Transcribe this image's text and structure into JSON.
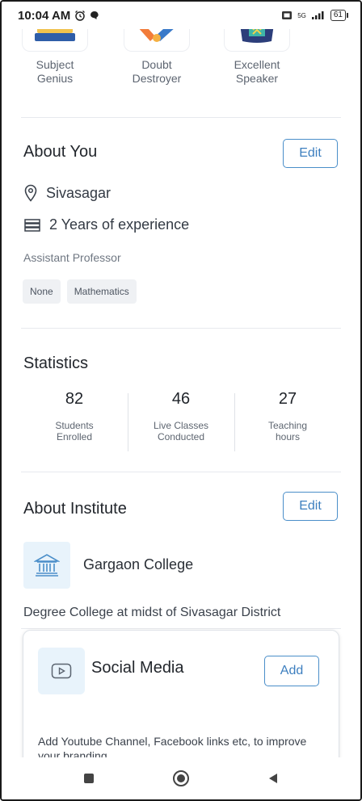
{
  "status_bar": {
    "time": "10:04 AM",
    "network": "5G",
    "battery": "61"
  },
  "badges": [
    {
      "label_line1": "Subject",
      "label_line2": "Genius",
      "icon": "books-badge-icon"
    },
    {
      "label_line1": "Doubt",
      "label_line2": "Destroyer",
      "icon": "doubt-badge-icon"
    },
    {
      "label_line1": "Excellent",
      "label_line2": "Speaker",
      "icon": "speaker-badge-icon"
    }
  ],
  "about_you": {
    "title": "About You",
    "edit_label": "Edit",
    "location": "Sivasagar",
    "experience": "2 Years of experience",
    "designation": "Assistant Professor",
    "tags": [
      "None",
      "Mathematics"
    ]
  },
  "statistics": {
    "title": "Statistics",
    "items": [
      {
        "value": "82",
        "label_line1": "Students",
        "label_line2": "Enrolled"
      },
      {
        "value": "46",
        "label_line1": "Live Classes",
        "label_line2": "Conducted"
      },
      {
        "value": "27",
        "label_line1": "Teaching",
        "label_line2": "hours"
      }
    ]
  },
  "about_institute": {
    "title": "About Institute",
    "edit_label": "Edit",
    "name": "Gargaon College",
    "description": "Degree College at midst of Sivasagar District"
  },
  "social_media": {
    "title": "Social Media",
    "add_label": "Add",
    "description": "Add Youtube Channel, Facebook links etc, to improve your branding."
  },
  "colors": {
    "accent": "#3d7fbf",
    "icon_bg": "#e8f3fb",
    "divider": "#e7e9ee"
  }
}
